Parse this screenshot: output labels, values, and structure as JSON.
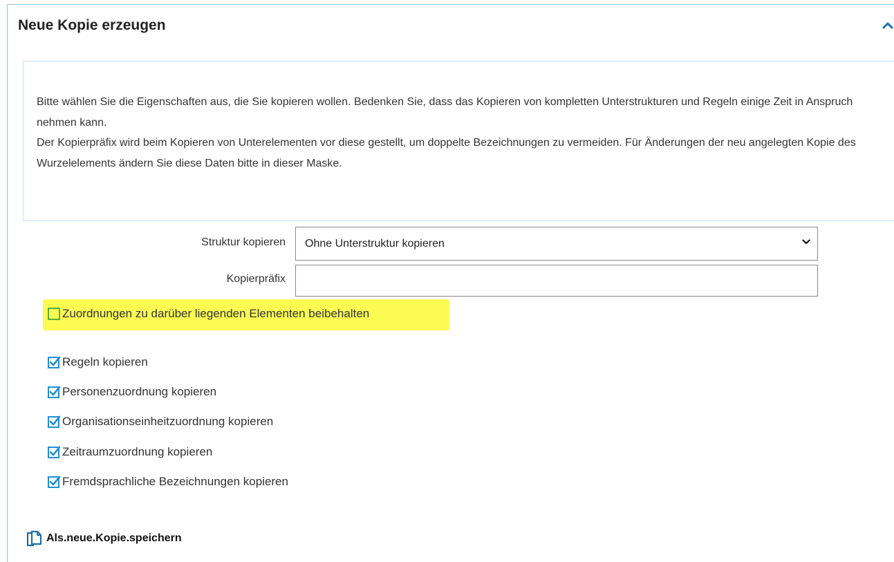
{
  "panel": {
    "title": "Neue Kopie erzeugen"
  },
  "info": {
    "paragraph1": "Bitte wählen Sie die Eigenschaften aus, die Sie kopieren wollen. Bedenken Sie, dass das Kopieren von kompletten Unterstrukturen und Regeln einige Zeit in Anspruch nehmen kann.",
    "paragraph2": "Der Kopierpräfix wird beim Kopieren von Unterelementen vor diese gestellt, um doppelte Bezeichnungen zu vermeiden. Für Änderungen der neu angelegten Kopie des Wurzelelements ändern Sie diese Daten bitte in dieser Maske."
  },
  "form": {
    "structure_label": "Struktur kopieren",
    "structure_value": "Ohne Unterstruktur kopieren",
    "prefix_label": "Kopierpräfix",
    "prefix_value": ""
  },
  "options": {
    "keep_assignments": {
      "label": "Zuordnungen zu darüber liegenden Elementen beibehalten",
      "checked": false
    },
    "rules": {
      "label": "Regeln kopieren",
      "checked": true
    },
    "persons": {
      "label": "Personenzuordnung kopieren",
      "checked": true
    },
    "org_units": {
      "label": "Organisationseinheitzuordnung kopieren",
      "checked": true
    },
    "periods": {
      "label": "Zeitraumzuordnung kopieren",
      "checked": true
    },
    "foreign_names": {
      "label": "Fremdsprachliche Bezeichnungen kopieren",
      "checked": true
    }
  },
  "actions": {
    "save_label": "Als.neue.Kopie.speichern"
  },
  "colors": {
    "accent": "#1e8fd6",
    "highlight": "#fbfb52",
    "unchecked_border": "#2e9a3a"
  }
}
